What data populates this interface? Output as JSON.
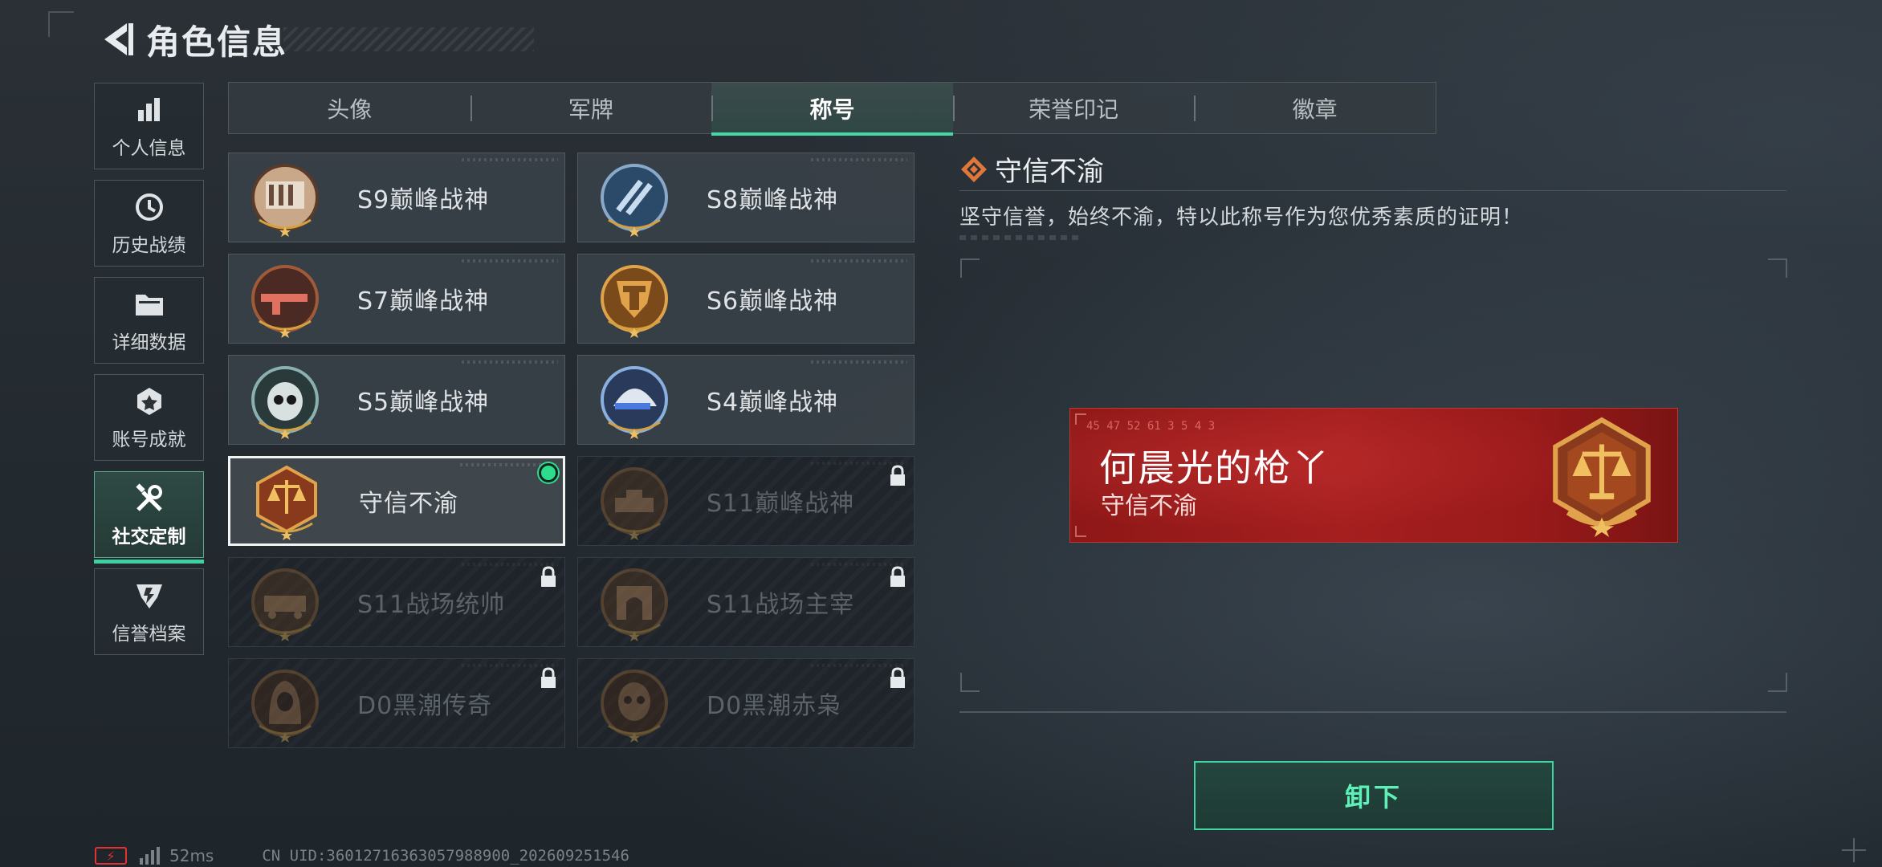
{
  "header": {
    "title": "角色信息"
  },
  "side_nav": [
    {
      "label": "个人信息",
      "icon": "bar-chart-icon"
    },
    {
      "label": "历史战绩",
      "icon": "history-clock-icon"
    },
    {
      "label": "详细数据",
      "icon": "folder-icon"
    },
    {
      "label": "账号成就",
      "icon": "achievement-badge-icon"
    },
    {
      "label": "社交定制",
      "icon": "tools-icon",
      "active": true
    },
    {
      "label": "信誉档案",
      "icon": "credit-shield-icon"
    }
  ],
  "tabs": [
    {
      "label": "头像"
    },
    {
      "label": "军牌"
    },
    {
      "label": "称号",
      "active": true
    },
    {
      "label": "荣誉印记"
    },
    {
      "label": "徽章"
    }
  ],
  "titles": [
    {
      "name": "S9巅峰战神",
      "emblem": "fortress-emblem",
      "locked": false
    },
    {
      "name": "S8巅峰战神",
      "emblem": "blue-slash-emblem",
      "locked": false
    },
    {
      "name": "S7巅峰战神",
      "emblem": "rifle-emblem",
      "locked": false
    },
    {
      "name": "S6巅峰战神",
      "emblem": "golden-crest-emblem",
      "locked": false
    },
    {
      "name": "S5巅峰战神",
      "emblem": "skull-helmet-emblem",
      "locked": false
    },
    {
      "name": "S4巅峰战神",
      "emblem": "tech-helmet-emblem",
      "locked": false
    },
    {
      "name": "守信不渝",
      "emblem": "scales-emblem",
      "locked": false,
      "selected": true,
      "equipped": true
    },
    {
      "name": "S11巅峰战神",
      "emblem": "tank-emblem",
      "locked": true
    },
    {
      "name": "S11战场统帅",
      "emblem": "armored-vehicle-emblem",
      "locked": true
    },
    {
      "name": "S11战场主宰",
      "emblem": "arch-emblem",
      "locked": true
    },
    {
      "name": "D0黑潮传奇",
      "emblem": "hooded-figure-emblem",
      "locked": true
    },
    {
      "name": "D0黑潮赤枭",
      "emblem": "masked-skull-emblem",
      "locked": true
    }
  ],
  "detail": {
    "title": "守信不渝",
    "description": "坚守信誉，始终不渝，特以此称号作为您优秀素质的证明！"
  },
  "banner": {
    "player_name": "何晨光的枪丫",
    "title": "守信不渝",
    "code": "45 47 52  61 3 5 4 3"
  },
  "actions": {
    "unequip_label": "卸下"
  },
  "status": {
    "ping": "52ms",
    "uid": "CN UID:3601271636305798890​0_202609251546"
  },
  "colors": {
    "accent": "#3fd59e",
    "banner_red": "#a51f1f",
    "gold": "#d99a3a"
  }
}
